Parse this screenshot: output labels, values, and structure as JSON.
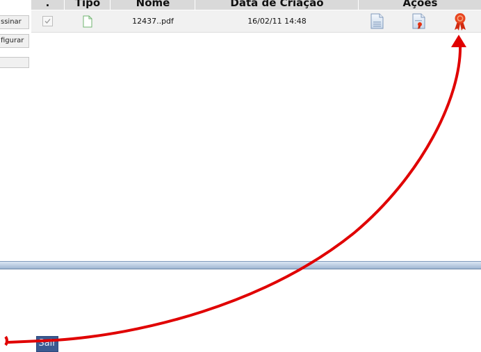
{
  "table": {
    "headers": {
      "select": ".",
      "type": "Tipo",
      "name": "Nome",
      "created": "Data de Criação",
      "actions": "Ações"
    },
    "rows": [
      {
        "checked": true,
        "type_icon": "file-icon",
        "name": "12437..pdf",
        "created": "16/02/11 14:48",
        "actions": [
          "view-document-icon",
          "certificate-document-icon",
          "award-ribbon-icon"
        ]
      }
    ]
  },
  "sidebar": {
    "buttons": [
      "ssinar",
      "figurar",
      ""
    ]
  },
  "footer": {
    "exit_label": "Sair"
  },
  "colors": {
    "annotation": "#e00000",
    "exit_button": "#3a5a91",
    "award": "#e63312"
  }
}
